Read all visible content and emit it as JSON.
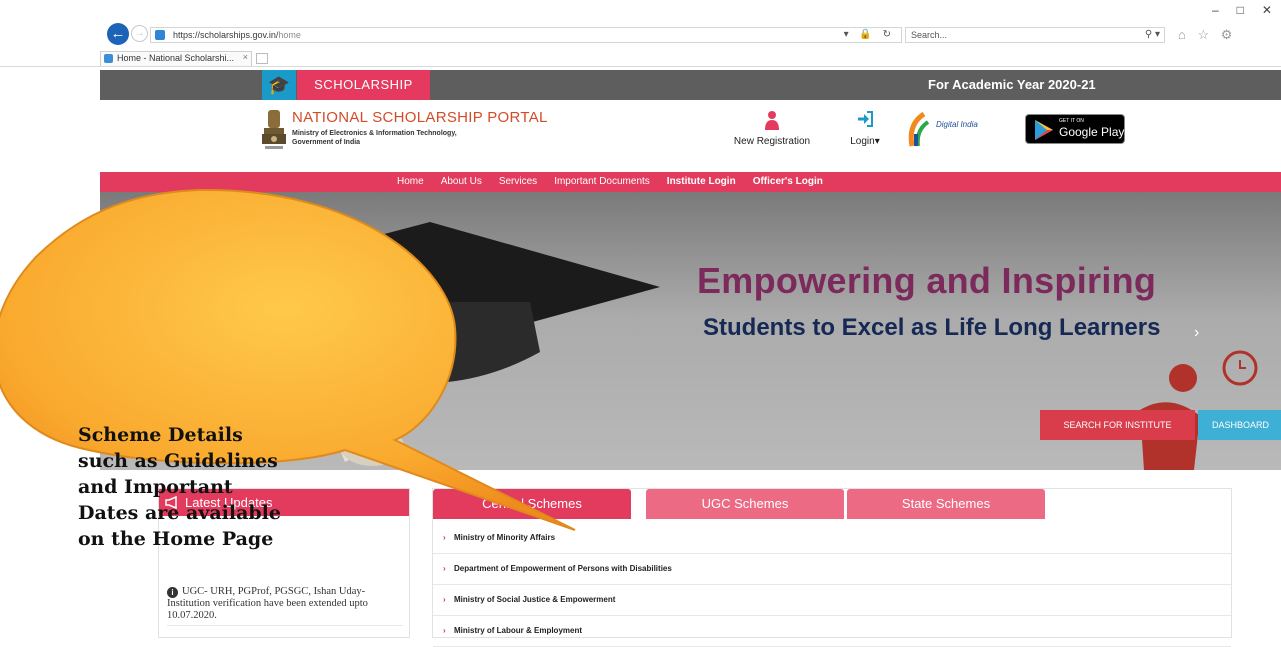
{
  "browser": {
    "url_host": "https://scholarships.gov.in/",
    "url_path": "home",
    "search_placeholder": "Search...",
    "tab_title": "Home - National Scholarshi...",
    "tab_close": "×"
  },
  "topbar": {
    "scholarship_label": "SCHOLARSHIP",
    "academic_year": "For Academic Year 2020-21"
  },
  "header": {
    "portal_title": "NATIONAL SCHOLARSHIP PORTAL",
    "ministry_line1": "Ministry of Electronics & Information Technology,",
    "ministry_line2": "Government of India",
    "new_registration": "New Registration",
    "login": "Login",
    "digital_india": "Digital India",
    "google_play_get": "GET IT ON",
    "google_play_name": "Google Play"
  },
  "nav": {
    "items": [
      {
        "label": "Home",
        "bold": false
      },
      {
        "label": "About Us",
        "bold": false
      },
      {
        "label": "Services",
        "bold": false
      },
      {
        "label": "Important Documents",
        "bold": false
      },
      {
        "label": "Institute Login",
        "bold": true
      },
      {
        "label": "Officer's Login",
        "bold": true
      }
    ]
  },
  "banner": {
    "headline": "Empowering and Inspiring",
    "subheadline": "Students to Excel as Life Long Learners",
    "search_institute": "SEARCH FOR INSTITUTE",
    "dashboard": "DASHBOARD"
  },
  "callout": {
    "lines": [
      "Scheme Details",
      "such as Guidelines",
      "and Important",
      "Dates are available",
      "on the Home Page"
    ]
  },
  "updates": {
    "title": "Latest Updates",
    "item": "UGC- URH, PGProf, PGSGC, Ishan Uday- Institution verification have been extended upto 10.07.2020."
  },
  "schemes": {
    "tabs": [
      "Central Schemes",
      "UGC Schemes",
      "State Schemes"
    ],
    "rows": [
      "Ministry of Minority Affairs",
      "Department of Empowerment of Persons with Disabilities",
      "Ministry of Social Justice & Empowerment",
      "Ministry of Labour & Employment"
    ]
  },
  "colors": {
    "brand_pink": "#e23b5d",
    "topbar_gray": "#5e5e5e",
    "callout_orange": "#f6a12a"
  }
}
